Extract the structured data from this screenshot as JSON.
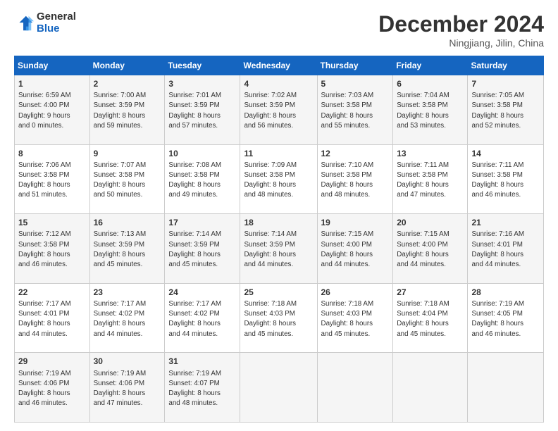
{
  "header": {
    "logo_line1": "General",
    "logo_line2": "Blue",
    "month_year": "December 2024",
    "location": "Ningjiang, Jilin, China"
  },
  "days_of_week": [
    "Sunday",
    "Monday",
    "Tuesday",
    "Wednesday",
    "Thursday",
    "Friday",
    "Saturday"
  ],
  "weeks": [
    [
      {
        "day": "1",
        "info": "Sunrise: 6:59 AM\nSunset: 4:00 PM\nDaylight: 9 hours\nand 0 minutes."
      },
      {
        "day": "2",
        "info": "Sunrise: 7:00 AM\nSunset: 3:59 PM\nDaylight: 8 hours\nand 59 minutes."
      },
      {
        "day": "3",
        "info": "Sunrise: 7:01 AM\nSunset: 3:59 PM\nDaylight: 8 hours\nand 57 minutes."
      },
      {
        "day": "4",
        "info": "Sunrise: 7:02 AM\nSunset: 3:59 PM\nDaylight: 8 hours\nand 56 minutes."
      },
      {
        "day": "5",
        "info": "Sunrise: 7:03 AM\nSunset: 3:58 PM\nDaylight: 8 hours\nand 55 minutes."
      },
      {
        "day": "6",
        "info": "Sunrise: 7:04 AM\nSunset: 3:58 PM\nDaylight: 8 hours\nand 53 minutes."
      },
      {
        "day": "7",
        "info": "Sunrise: 7:05 AM\nSunset: 3:58 PM\nDaylight: 8 hours\nand 52 minutes."
      }
    ],
    [
      {
        "day": "8",
        "info": "Sunrise: 7:06 AM\nSunset: 3:58 PM\nDaylight: 8 hours\nand 51 minutes."
      },
      {
        "day": "9",
        "info": "Sunrise: 7:07 AM\nSunset: 3:58 PM\nDaylight: 8 hours\nand 50 minutes."
      },
      {
        "day": "10",
        "info": "Sunrise: 7:08 AM\nSunset: 3:58 PM\nDaylight: 8 hours\nand 49 minutes."
      },
      {
        "day": "11",
        "info": "Sunrise: 7:09 AM\nSunset: 3:58 PM\nDaylight: 8 hours\nand 48 minutes."
      },
      {
        "day": "12",
        "info": "Sunrise: 7:10 AM\nSunset: 3:58 PM\nDaylight: 8 hours\nand 48 minutes."
      },
      {
        "day": "13",
        "info": "Sunrise: 7:11 AM\nSunset: 3:58 PM\nDaylight: 8 hours\nand 47 minutes."
      },
      {
        "day": "14",
        "info": "Sunrise: 7:11 AM\nSunset: 3:58 PM\nDaylight: 8 hours\nand 46 minutes."
      }
    ],
    [
      {
        "day": "15",
        "info": "Sunrise: 7:12 AM\nSunset: 3:58 PM\nDaylight: 8 hours\nand 46 minutes."
      },
      {
        "day": "16",
        "info": "Sunrise: 7:13 AM\nSunset: 3:59 PM\nDaylight: 8 hours\nand 45 minutes."
      },
      {
        "day": "17",
        "info": "Sunrise: 7:14 AM\nSunset: 3:59 PM\nDaylight: 8 hours\nand 45 minutes."
      },
      {
        "day": "18",
        "info": "Sunrise: 7:14 AM\nSunset: 3:59 PM\nDaylight: 8 hours\nand 44 minutes."
      },
      {
        "day": "19",
        "info": "Sunrise: 7:15 AM\nSunset: 4:00 PM\nDaylight: 8 hours\nand 44 minutes."
      },
      {
        "day": "20",
        "info": "Sunrise: 7:15 AM\nSunset: 4:00 PM\nDaylight: 8 hours\nand 44 minutes."
      },
      {
        "day": "21",
        "info": "Sunrise: 7:16 AM\nSunset: 4:01 PM\nDaylight: 8 hours\nand 44 minutes."
      }
    ],
    [
      {
        "day": "22",
        "info": "Sunrise: 7:17 AM\nSunset: 4:01 PM\nDaylight: 8 hours\nand 44 minutes."
      },
      {
        "day": "23",
        "info": "Sunrise: 7:17 AM\nSunset: 4:02 PM\nDaylight: 8 hours\nand 44 minutes."
      },
      {
        "day": "24",
        "info": "Sunrise: 7:17 AM\nSunset: 4:02 PM\nDaylight: 8 hours\nand 44 minutes."
      },
      {
        "day": "25",
        "info": "Sunrise: 7:18 AM\nSunset: 4:03 PM\nDaylight: 8 hours\nand 45 minutes."
      },
      {
        "day": "26",
        "info": "Sunrise: 7:18 AM\nSunset: 4:03 PM\nDaylight: 8 hours\nand 45 minutes."
      },
      {
        "day": "27",
        "info": "Sunrise: 7:18 AM\nSunset: 4:04 PM\nDaylight: 8 hours\nand 45 minutes."
      },
      {
        "day": "28",
        "info": "Sunrise: 7:19 AM\nSunset: 4:05 PM\nDaylight: 8 hours\nand 46 minutes."
      }
    ],
    [
      {
        "day": "29",
        "info": "Sunrise: 7:19 AM\nSunset: 4:06 PM\nDaylight: 8 hours\nand 46 minutes."
      },
      {
        "day": "30",
        "info": "Sunrise: 7:19 AM\nSunset: 4:06 PM\nDaylight: 8 hours\nand 47 minutes."
      },
      {
        "day": "31",
        "info": "Sunrise: 7:19 AM\nSunset: 4:07 PM\nDaylight: 8 hours\nand 48 minutes."
      },
      null,
      null,
      null,
      null
    ]
  ]
}
